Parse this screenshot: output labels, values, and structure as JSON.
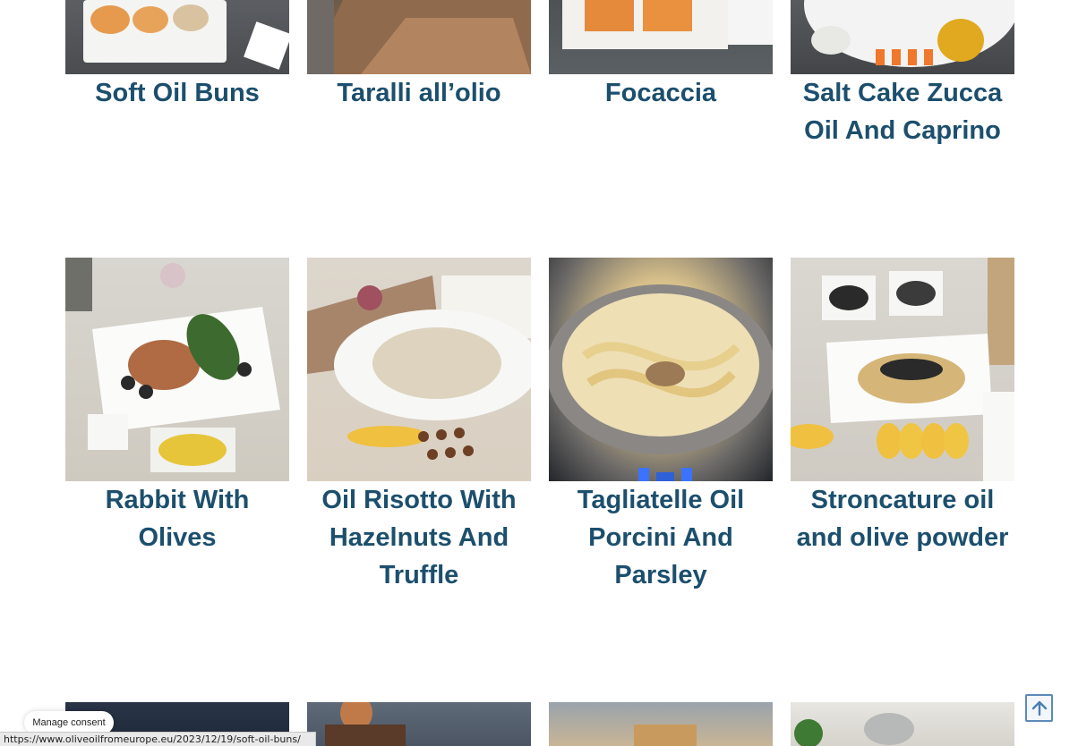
{
  "recipes_row1": [
    {
      "title": "Soft Oil Buns"
    },
    {
      "title": "Taralli all’olio"
    },
    {
      "title": "Focaccia"
    },
    {
      "title": "Salt Cake Zucca Oil And Caprino"
    }
  ],
  "recipes_row2": [
    {
      "title": "Rabbit With Olives"
    },
    {
      "title": "Oil Risotto With Hazelnuts And Truffle"
    },
    {
      "title": "Tagliatelle Oil Porcini And Parsley"
    },
    {
      "title": "Stroncature oil and olive powder"
    }
  ],
  "consent": {
    "label": "Manage consent"
  },
  "status_bar": {
    "url": "https://www.oliveoilfromeurope.eu/2023/12/19/soft-oil-buns/"
  },
  "scroll_top": {
    "icon": "arrow-up-icon"
  },
  "colors": {
    "title": "#1c4f6d",
    "accent": "#5b8bb8"
  }
}
